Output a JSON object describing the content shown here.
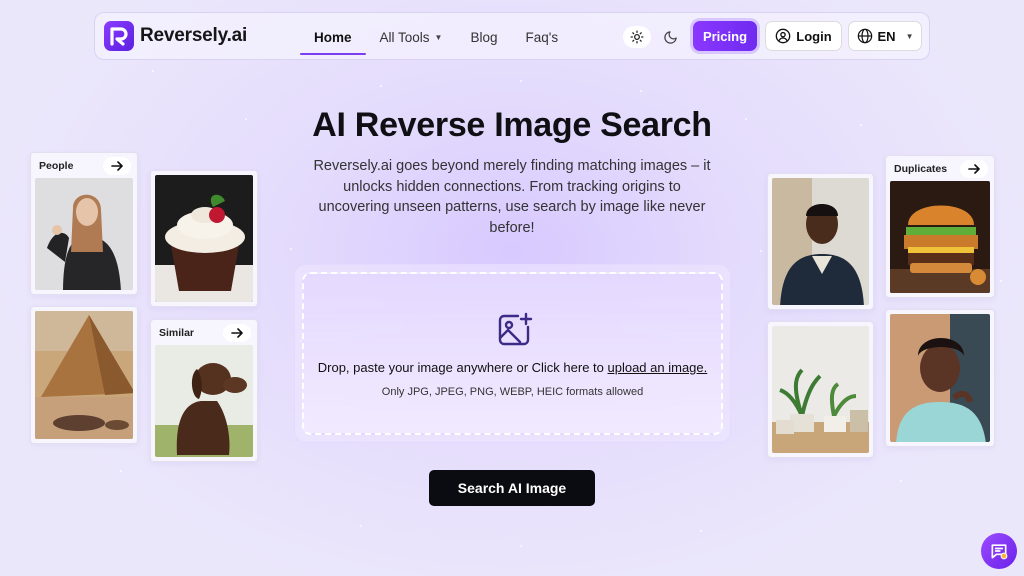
{
  "brand": {
    "name": "Reversely.ai",
    "accent": "#7b2ff7"
  },
  "nav": {
    "links": [
      {
        "label": "Home",
        "active": true
      },
      {
        "label": "All Tools",
        "has_dropdown": true
      },
      {
        "label": "Blog"
      },
      {
        "label": "Faq's"
      }
    ],
    "theme_toggle": {
      "light_icon": "sun-icon",
      "dark_icon": "moon-icon",
      "selected": "light"
    },
    "pricing_label": "Pricing",
    "login_label": "Login",
    "language_label": "EN"
  },
  "hero": {
    "title": "AI Reverse Image Search",
    "description": "Reversely.ai goes beyond merely finding matching images – it unlocks hidden connections. From tracking origins to uncovering unseen patterns, use search by image like never before!"
  },
  "upload": {
    "prompt_text": "Drop, paste your image anywhere or Click here to ",
    "link_text": "upload an image.",
    "formats_text": "Only JPG, JPEG, PNG, WEBP, HEIC formats allowed"
  },
  "search_button_label": "Search AI Image",
  "cards": {
    "people": "People",
    "similar": "Similar",
    "duplicates": "Duplicates"
  }
}
